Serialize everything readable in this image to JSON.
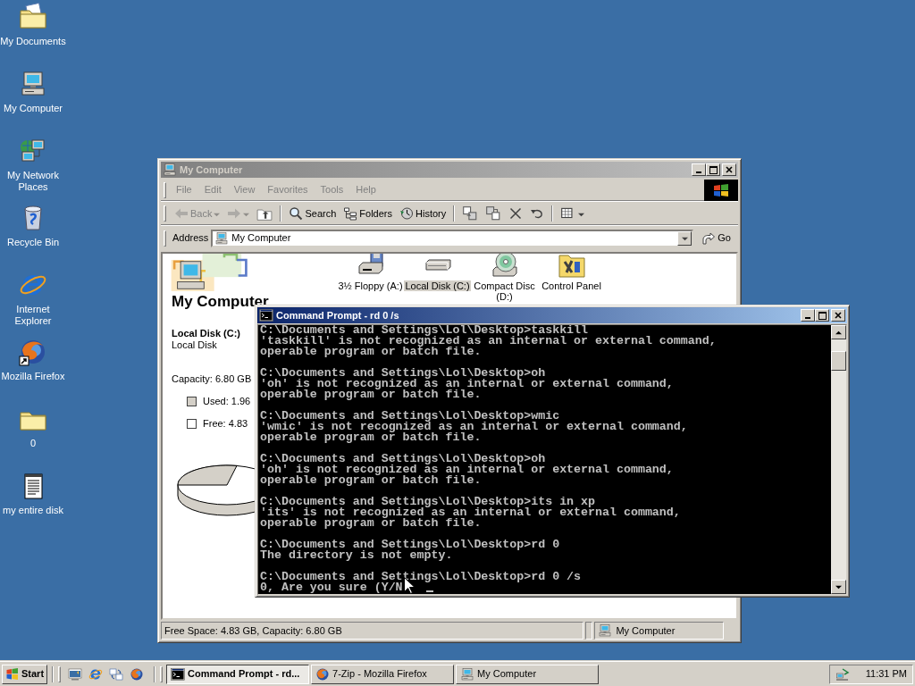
{
  "desktop_icons": [
    {
      "label": "My Documents",
      "kind": "documents"
    },
    {
      "label": "My Computer",
      "kind": "computer"
    },
    {
      "label": "My Network Places",
      "kind": "network"
    },
    {
      "label": "Recycle Bin",
      "kind": "recycle"
    },
    {
      "label": "Internet Explorer",
      "kind": "ie"
    },
    {
      "label": "Mozilla Firefox",
      "kind": "firefox"
    },
    {
      "label": "0",
      "kind": "folder"
    },
    {
      "label": "my entire disk",
      "kind": "text"
    }
  ],
  "explorer": {
    "title": "My Computer",
    "active": false,
    "menu": [
      "File",
      "Edit",
      "View",
      "Favorites",
      "Tools",
      "Help"
    ],
    "toolbar": [
      {
        "kind": "back",
        "label": "Back",
        "disabled": true
      },
      {
        "kind": "forward",
        "disabled": true
      },
      {
        "kind": "up",
        "disabled": false
      },
      {
        "kind": "search",
        "label": "Search",
        "disabled": false
      },
      {
        "kind": "folders",
        "label": "Folders",
        "disabled": false
      },
      {
        "kind": "history",
        "label": "History",
        "disabled": false
      },
      {
        "kind": "move",
        "disabled": false
      },
      {
        "kind": "copy",
        "disabled": false
      },
      {
        "kind": "delete",
        "disabled": false
      },
      {
        "kind": "undo",
        "disabled": false
      },
      {
        "kind": "views",
        "disabled": false
      }
    ],
    "address": {
      "label": "Address",
      "value": "My Computer",
      "go": "Go"
    },
    "heading": "My Computer",
    "drive_name": "Local Disk (C:)",
    "drive_type": "Local Disk",
    "capacity": "Capacity: 6.80 GB",
    "legend": [
      {
        "label": "Used: 1.96",
        "color": "#d4d0c8"
      },
      {
        "label": "Free: 4.83",
        "color": "#ffffff"
      }
    ],
    "items": [
      {
        "label": "3½ Floppy (A:)",
        "kind": "floppy",
        "selected": false
      },
      {
        "label": "Local Disk (C:)",
        "kind": "disk",
        "selected": true
      },
      {
        "label": "Compact Disc (D:)",
        "kind": "cd",
        "selected": false
      },
      {
        "label": "Control Panel",
        "kind": "control",
        "selected": false
      }
    ],
    "status_text": "Free Space: 4.83 GB, Capacity: 6.80 GB",
    "status_zone": "My Computer"
  },
  "console": {
    "title": "Command Prompt - rd 0 /s",
    "active": true,
    "blocks": [
      [
        "C:\\Documents and Settings\\Lol\\Desktop>taskkill",
        "'taskkill' is not recognized as an internal or external command,",
        "operable program or batch file."
      ],
      [
        "C:\\Documents and Settings\\Lol\\Desktop>oh",
        "'oh' is not recognized as an internal or external command,",
        "operable program or batch file."
      ],
      [
        "C:\\Documents and Settings\\Lol\\Desktop>wmic",
        "'wmic' is not recognized as an internal or external command,",
        "operable program or batch file."
      ],
      [
        "C:\\Documents and Settings\\Lol\\Desktop>oh",
        "'oh' is not recognized as an internal or external command,",
        "operable program or batch file."
      ],
      [
        "C:\\Documents and Settings\\Lol\\Desktop>its in xp",
        "'its' is not recognized as an internal or external command,",
        "operable program or batch file."
      ],
      [
        "C:\\Documents and Settings\\Lol\\Desktop>rd 0",
        "The directory is not empty."
      ],
      [
        "C:\\Documents and Settings\\Lol\\Desktop>rd 0 /s",
        "0, Are you sure (Y/N"
      ]
    ]
  },
  "taskbar": {
    "start": "Start",
    "quick_launch": [
      {
        "kind": "desktop"
      },
      {
        "kind": "ie"
      },
      {
        "kind": "channels"
      },
      {
        "kind": "firefox"
      }
    ],
    "tasks": [
      {
        "label": "Command Prompt - rd...",
        "kind": "console",
        "selected": true
      },
      {
        "label": "7-Zip - Mozilla Firefox",
        "kind": "firefox",
        "selected": false
      },
      {
        "label": "My Computer",
        "kind": "computer",
        "selected": false
      }
    ],
    "clock": "11:31 PM"
  }
}
